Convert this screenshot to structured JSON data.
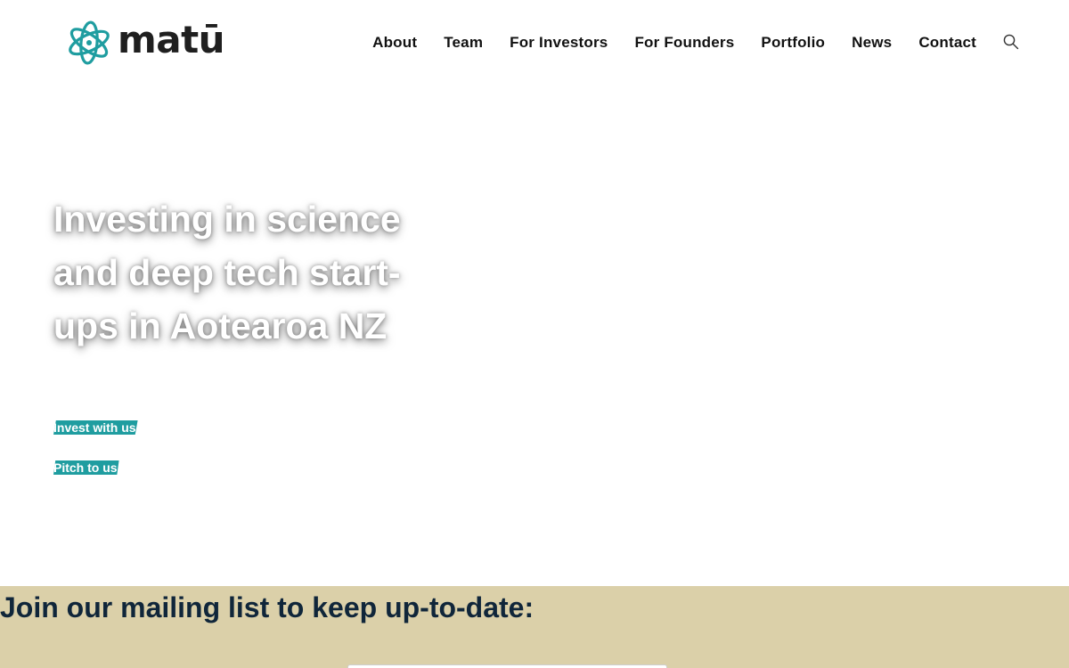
{
  "brand": {
    "name": "matū",
    "accent_color": "#1f9da0",
    "logo_icon": "atom-icon"
  },
  "nav": {
    "items": [
      {
        "label": "About"
      },
      {
        "label": "Team"
      },
      {
        "label": "For Investors"
      },
      {
        "label": "For Founders"
      },
      {
        "label": "Portfolio"
      },
      {
        "label": "News"
      },
      {
        "label": "Contact"
      }
    ],
    "search_icon": "search-icon"
  },
  "hero": {
    "title": "Investing in science and deep tech start-ups in Aotearoa NZ",
    "invest_label": "Invest with us",
    "pitch_label": "Pitch to us",
    "button_color": "#1f9da0"
  },
  "mailing": {
    "title": "Join our mailing list to keep up-to-date:",
    "background_color": "#dbd0a9",
    "title_color": "#10263a"
  }
}
